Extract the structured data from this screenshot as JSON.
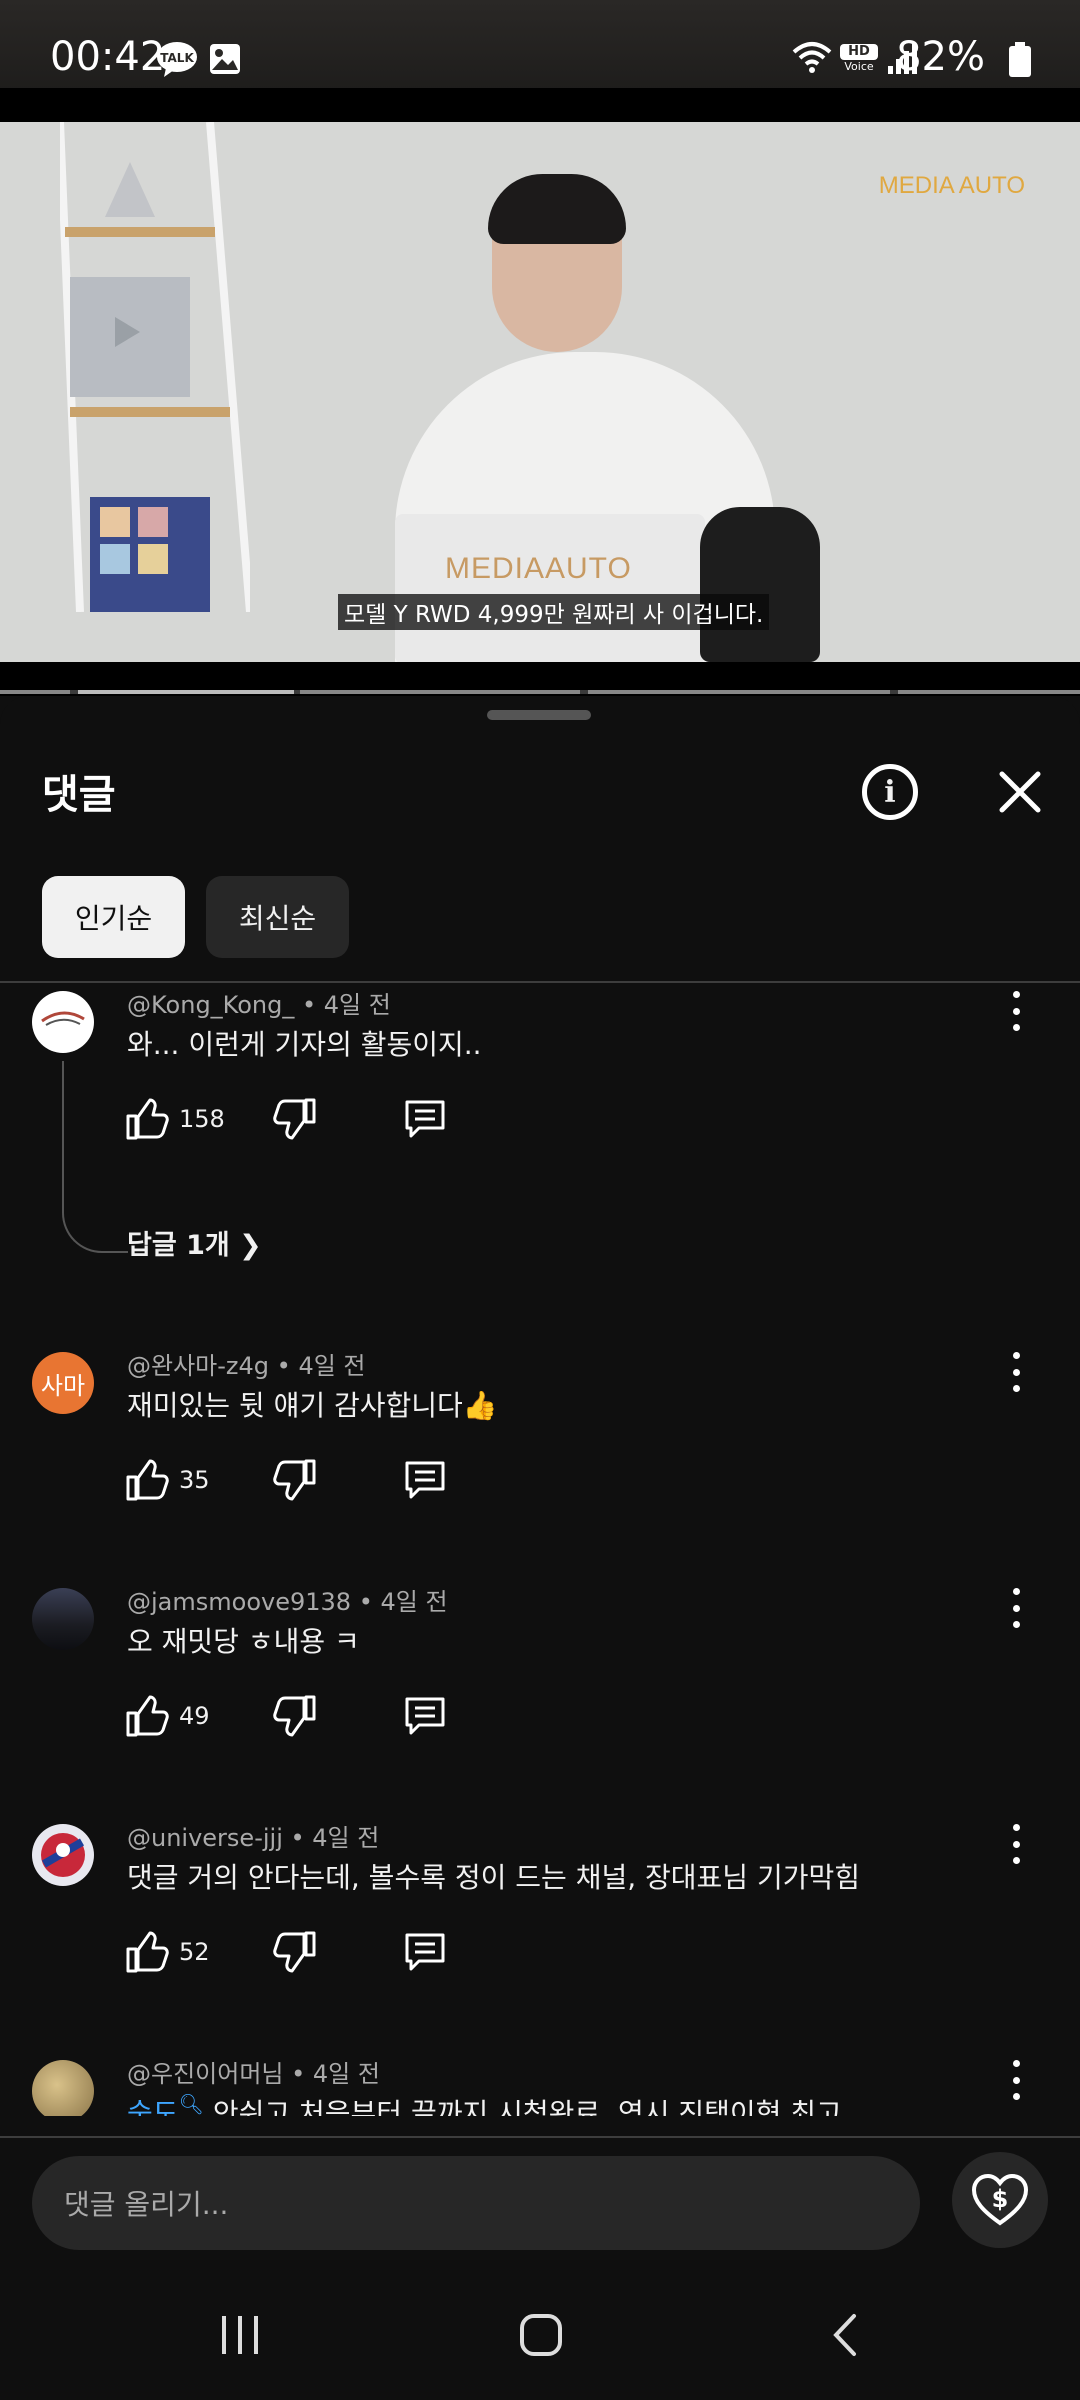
{
  "status_bar": {
    "time": "00:42",
    "battery": "82%",
    "voice_badge_top": "HD",
    "voice_badge_bottom": "Voice"
  },
  "video": {
    "brand": "MEDIA AUTO",
    "laptop_brand": "MEDIAAUTO",
    "subtitle": "모델 Y RWD 4,999만 원짜리 사 이겁니다."
  },
  "panel": {
    "title": "댓글",
    "sort": {
      "popular": "인기순",
      "newest": "최신순"
    }
  },
  "comments": [
    {
      "author": "@Kong_Kong_",
      "time": "4일 전",
      "text": "와... 이런게 기자의 활동이지..",
      "likes": "158",
      "replies": "답글 1개"
    },
    {
      "author": "@완사마-z4g",
      "time": "4일 전",
      "text": "재미있는 뒷 얘기 감사합니다👍",
      "likes": "35",
      "avatar_text": "사마",
      "avatar_color": "#e87532"
    },
    {
      "author": "@jamsmoove9138",
      "time": "4일 전",
      "text": "오 재밋당 ㅎ내용 ㅋ",
      "likes": "49"
    },
    {
      "author": "@universe-jjj",
      "time": "4일 전",
      "text": "댓글 거의 안다는데, 볼수록 정이 드는 채널, 장대표님 기가막힘",
      "likes": "52"
    },
    {
      "author": "@우진이어머님",
      "time": "4일 전",
      "mention": "숨도",
      "text": " 안쉬고 처음부터 끝까지 시청완료..역시 진택이형 최고"
    }
  ],
  "input": {
    "placeholder": "댓글 올리기..."
  },
  "icons": {
    "info": "i"
  }
}
